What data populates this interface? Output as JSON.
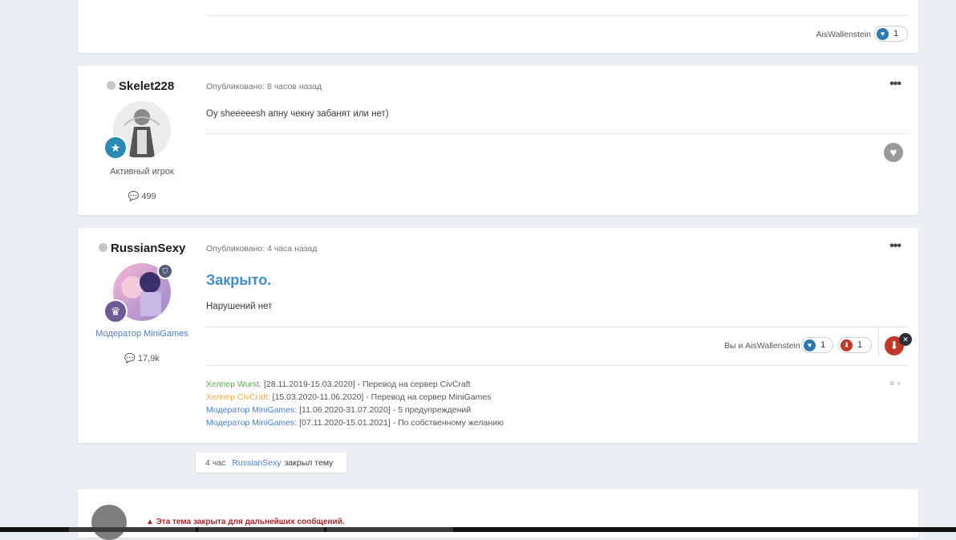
{
  "post0": {
    "reacting_users": "AisWallenstein",
    "like_count": "1"
  },
  "post1": {
    "username": "Skelet228",
    "user_title": "Активный игрок",
    "post_count": "499",
    "meta": "Опубликовано: 8 часов назад",
    "content": "Oy sheeeeesh апну чекну забанят или нет)"
  },
  "post2": {
    "username": "RussianSexy",
    "user_title": "Модератор MiniGames",
    "post_count": "17,9k",
    "meta": "Опубликовано: 4 часа назад",
    "heading": "Закрыто.",
    "content": "Нарушений нет",
    "reacting_users": "Вы и AisWallenstein",
    "like_count": "1",
    "dislike_count": "1",
    "signature": [
      {
        "role": "Хелпер Wurst:",
        "text": " [28.11.2019-15.03.2020] - Перевод на сервер CivCraft"
      },
      {
        "role": "Хелпер CivCraft:",
        "text": " [15.03.2020-11.06.2020] - Перевод на сервер MiniGames"
      },
      {
        "role": "Модератор MiniGames:",
        "text": " [11.06.2020-31.07.2020] - 5 предупреждений"
      },
      {
        "role": "Модератор MiniGames:",
        "text": " [07.11.2020-15.01.2021] - По собственному желанию"
      }
    ]
  },
  "event": {
    "time": "4 час",
    "user": "RussianSexy",
    "action": "закрыл тему"
  },
  "notice": {
    "text": "Эта тема закрыта для дальнейших сообщений."
  },
  "colors": {
    "accent": "#3d8fd1",
    "like": "#2b79b3",
    "dislike": "#c0392b",
    "notice": "#b22222"
  }
}
